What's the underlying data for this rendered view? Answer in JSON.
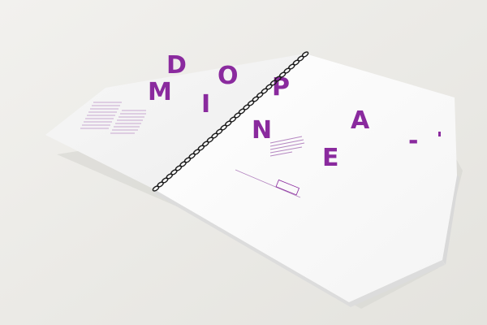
{
  "colors": {
    "background": "#e9e8e4",
    "page": "#fbfbfb",
    "accent_purple": "#8a2a9e",
    "text_lines": "#c9a7d2",
    "spiral_coil": "#1b1b1b"
  },
  "spread": {
    "title_row_1": [
      "D",
      "O",
      "P",
      "A",
      "-"
    ],
    "title_row_2": [
      "M",
      "I",
      "N",
      "E"
    ],
    "left_page": {
      "text_block_note": "illegible tiny purple body text columns"
    },
    "right_page": {
      "paragraph_note": "illegible small purple paragraph",
      "caption_note": "illegible caption line with boxed highlight"
    }
  },
  "binding": {
    "type": "spiral",
    "coil_count": 34
  }
}
